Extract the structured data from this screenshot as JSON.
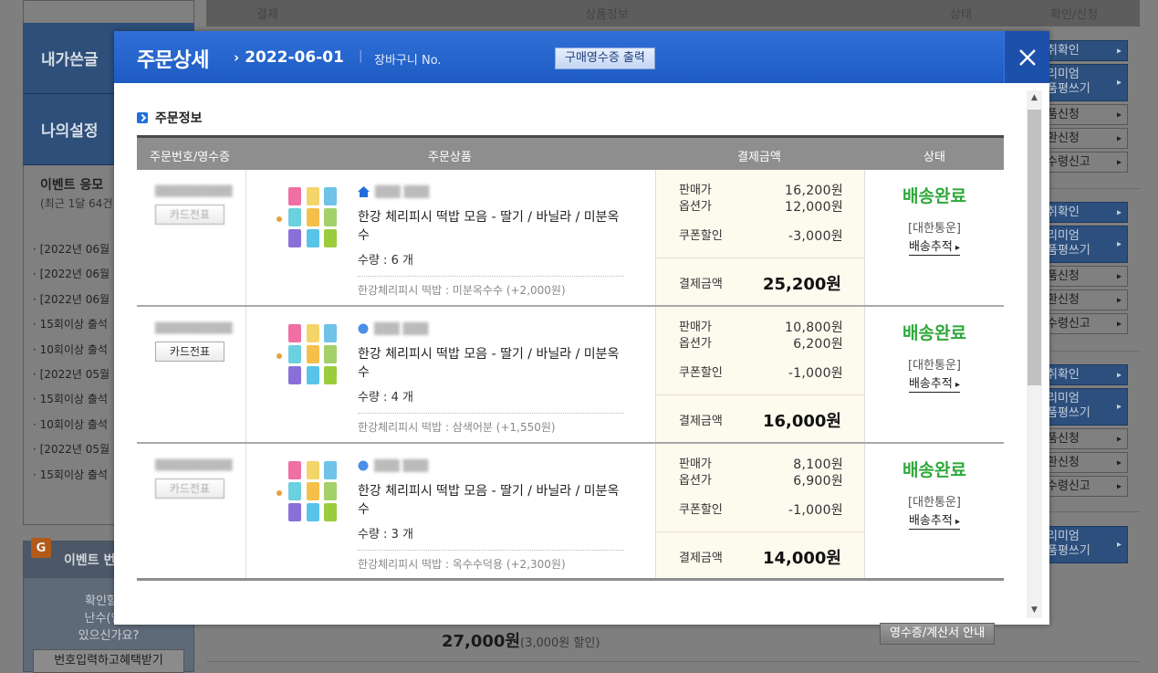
{
  "background": {
    "table_head": [
      "결제",
      "상품정보",
      "상태",
      "확인/신청"
    ],
    "nav": [
      "내가쓴글",
      "나의설정"
    ],
    "event": {
      "title": "이벤트 응모",
      "sub": "(최근 1달 64건"
    },
    "event_list": [
      "[2022년 06월",
      "[2022년 06월",
      "[2022년 06월",
      "15회이상 출석",
      "10회이상 출석",
      "[2022년 05월",
      "15회이상 출석",
      "10회이상 출석",
      "[2022년 05월",
      "15회이상 출석"
    ],
    "event_box": {
      "badge": "G",
      "title": "이벤트 번",
      "text": "확인할 수\n난수(인증\n있으신가요?",
      "button": "번호입력하고혜택받기"
    },
    "right_buttons": [
      "취확인",
      "리미엄\n품평쓰기",
      "품신청",
      "환신청",
      "수령신고",
      "취확인",
      "리미엄\n품평쓰기",
      "품신청",
      "환신청",
      "수령신고",
      "취확인",
      "리미엄\n품평쓰기",
      "품신청",
      "환신청",
      "수령신고",
      "리미엄\n품평쓰기"
    ],
    "bottom_price": "27,000원",
    "bottom_discount": "(3,000원 할인)"
  },
  "modal": {
    "title": "주문상세",
    "date": "2022-06-01",
    "cart_label": "장바구니 No.",
    "cart_no": "",
    "receipt_button": "구매영수증 출력",
    "close_icon": "close-icon",
    "section_title": "주문정보",
    "table_headers": [
      "주문번호/영수증",
      "주문상품",
      "결제금액",
      "상태"
    ],
    "orders": [
      {
        "card_button": "카드전표",
        "product_name": "한강 체리피시 떡밥 모음 - 딸기 / 바닐라 / 미분옥수",
        "qty": "수량 : 6 개",
        "option": "한강체리피시 떡밥 : 미분옥수수 (+2,000원)",
        "sale_label": "판매가",
        "sale": "16,200원",
        "option_label": "옵션가",
        "option_price": "12,000원",
        "coupon_label": "쿠폰할인",
        "coupon": "-3,000원",
        "total_label": "결제금액",
        "total": "25,200원",
        "status": "배송완료",
        "carrier": "[대한통운]",
        "track": "배송추적"
      },
      {
        "card_button": "카드전표",
        "product_name": "한강 체리피시 떡밥 모음 - 딸기 / 바닐라 / 미분옥수",
        "qty": "수량 : 4 개",
        "option": "한강체리피시 떡밥 : 삼색어분 (+1,550원)",
        "sale_label": "판매가",
        "sale": "10,800원",
        "option_label": "옵션가",
        "option_price": "6,200원",
        "coupon_label": "쿠폰할인",
        "coupon": "-1,000원",
        "total_label": "결제금액",
        "total": "16,000원",
        "status": "배송완료",
        "carrier": "[대한통운]",
        "track": "배송추적"
      },
      {
        "card_button": "카드전표",
        "product_name": "한강 체리피시 떡밥 모음 - 딸기 / 바닐라 / 미분옥수",
        "qty": "수량 : 3 개",
        "option": "한강체리피시 떡밥 : 옥수수덕용 (+2,300원)",
        "sale_label": "판매가",
        "sale": "8,100원",
        "option_label": "옵션가",
        "option_price": "6,900원",
        "coupon_label": "쿠폰할인",
        "coupon": "-1,000원",
        "total_label": "결제금액",
        "total": "14,000원",
        "status": "배송완료",
        "carrier": "[대한통운]",
        "track": "배송추적"
      }
    ],
    "receipt_info_button": "영수증/계산서 안내"
  },
  "colors": {
    "modal_header": "#2169d2",
    "status_done": "#2ea83a",
    "accent": "#1e6fd9"
  }
}
